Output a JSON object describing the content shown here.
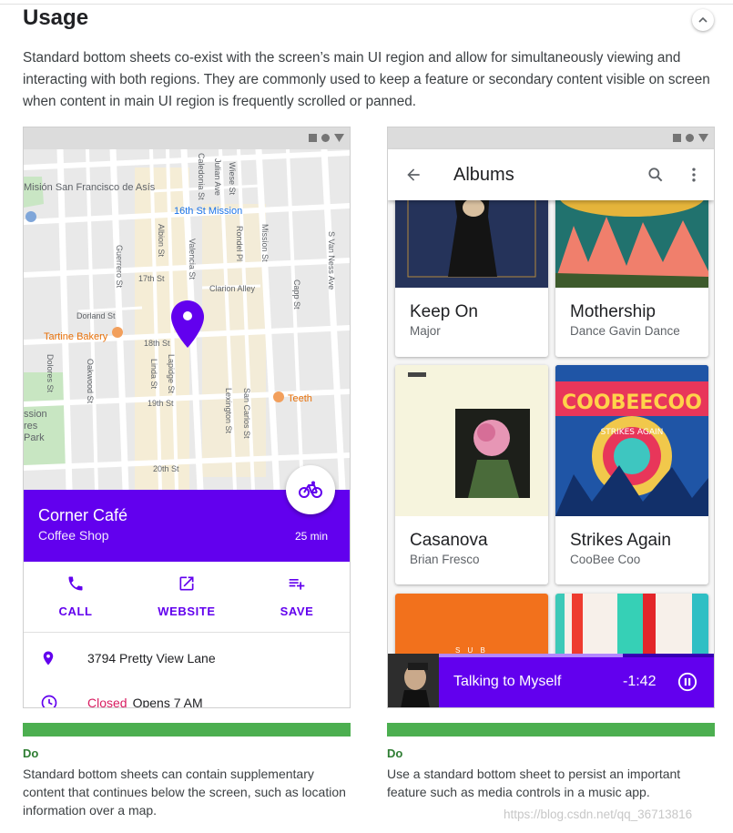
{
  "section": {
    "title": "Usage",
    "intro": "Standard bottom sheets co-exist with the screen’s main UI region and allow for simultaneously viewing and interacting with both regions. They are commonly used to keep a feature or secondary content visible on screen when content in main UI region is frequently scrolled or panned."
  },
  "map_example": {
    "map_labels": {
      "mission_san_francisco": "Misión San Francisco de Asís",
      "transit": "16th St Mission",
      "tartine": "Tartine Bakery",
      "teeth": "Teeth",
      "park": "ssion res Park",
      "dolores_st": "Dolores St",
      "guerrero_st": "Guerrero St",
      "valencia_st": "Valencia St",
      "mission_st": "Mission St",
      "s_van_ness": "S Van Ness Ave",
      "capp_st": "Capp St",
      "st17": "17th St",
      "st18": "18th St",
      "st19": "19th St",
      "st20": "20th St",
      "clarion": "Clarion Alley",
      "dorland": "Dorland St",
      "lapidge": "Lapidge St",
      "linda": "Linda St",
      "oakwood": "Oakwood St",
      "lexington": "Lexington St",
      "san_carlos": "San Carlos St",
      "albion": "Albion St",
      "caledonia": "Caledonia St",
      "julian": "Julian Ave",
      "wiese": "Wiese St",
      "rondel": "Rondel Pl"
    },
    "place": {
      "name": "Corner Café",
      "type": "Coffee Shop",
      "travel_time": "25 min"
    },
    "actions": [
      {
        "label": "CALL",
        "icon": "phone-icon"
      },
      {
        "label": "WEBSITE",
        "icon": "open-in-new-icon"
      },
      {
        "label": "SAVE",
        "icon": "playlist-add-icon"
      }
    ],
    "address": "3794 Pretty View Lane",
    "hours": {
      "status": "Closed",
      "opens": "Opens 7 AM"
    }
  },
  "music_example": {
    "appbar_title": "Albums",
    "albums": [
      {
        "title": "Keep On",
        "artist": "Major"
      },
      {
        "title": "Mothership",
        "artist": "Dance Gavin Dance"
      },
      {
        "title": "Casanova",
        "artist": "Brian Fresco"
      },
      {
        "title": "Strikes Again",
        "artist": "CooBee Coo"
      }
    ],
    "album_art_text": {
      "coobee": "COOBEECOO",
      "strikes": "STRIKES AGAIN",
      "partial_mark": "S U B"
    },
    "now_playing": {
      "song": "Talking to Myself",
      "time": "-1:42",
      "progress": 0.72
    }
  },
  "guidelines": [
    {
      "verdict": "Do",
      "text": "Standard bottom sheets can contain supplementary content that continues below the screen, such as location information over a map."
    },
    {
      "verdict": "Do",
      "text": "Use a standard bottom sheet to persist an important feature such as media controls in a music app."
    }
  ],
  "watermark": "https://blog.csdn.net/qq_36713816",
  "colors": {
    "primary": "#6200ee",
    "do_bar": "#4caf50",
    "closed": "#d81b60"
  }
}
